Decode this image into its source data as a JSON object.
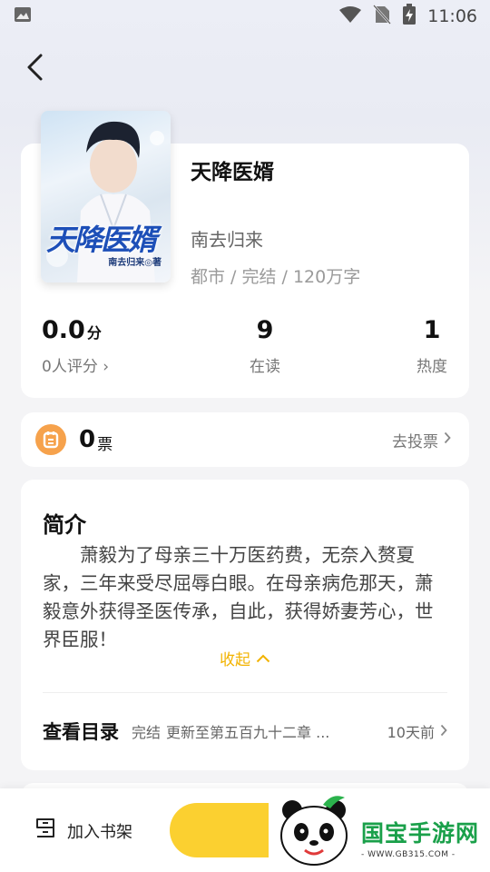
{
  "status_bar": {
    "time": "11:06",
    "icons": [
      "gallery-icon",
      "wifi-icon",
      "no-sim-icon",
      "battery-charging-icon"
    ]
  },
  "nav": {
    "back_icon": "chevron-left-icon"
  },
  "book": {
    "title": "天降医婿",
    "author": "南去归来",
    "meta": "都市 / 完结 / 120万字",
    "cover": {
      "title": "天降医婿",
      "author": "南去归来◎著"
    }
  },
  "stats": {
    "score": {
      "value": "0.0",
      "unit": "分",
      "label": "0人评分 ›"
    },
    "readers": {
      "value": "9",
      "label": "在读"
    },
    "heat": {
      "value": "1",
      "label": "热度"
    }
  },
  "vote": {
    "count": "0",
    "unit": "票",
    "link": "去投票"
  },
  "intro": {
    "heading": "简介",
    "text": "萧毅为了母亲三十万医药费，无奈入赘夏家，三年来受尽屈辱白眼。在母亲病危那天，萧毅意外获得圣医传承，自此，获得娇妻芳心，世界臣服！",
    "collapse": "收起"
  },
  "toc": {
    "title": "查看目录",
    "status": "完结",
    "latest": "更新至第五百九十二章 ...",
    "time": "10天前"
  },
  "bottom": {
    "shelf_label": "加入书架"
  },
  "watermark": {
    "brand": "国宝手游网",
    "url": "- WWW.GB315.COM -"
  },
  "colors": {
    "accent": "#fbd030",
    "collapse": "#f2b300",
    "ticket": "#f6a24c",
    "watermark": "#1aa04a"
  }
}
